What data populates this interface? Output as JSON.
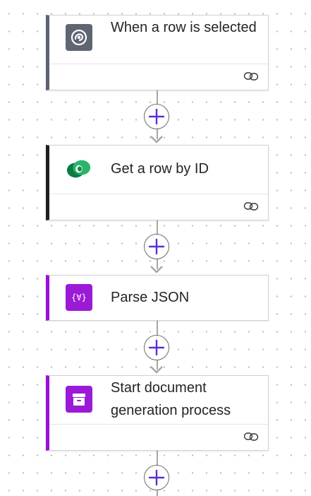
{
  "flow": {
    "steps": [
      {
        "title": "When a row is selected",
        "icon": "dataverse-icon",
        "accent": "#5c6473",
        "icon_bg": "#5f6672",
        "has_link": true
      },
      {
        "title": "Get a row by ID",
        "icon": "dataverse-logo-icon",
        "accent": "#1f1f1f",
        "icon_bg": "#ffffff",
        "has_link": true
      },
      {
        "title": "Parse JSON",
        "icon": "data-operation-icon",
        "accent": "#9b10d9",
        "icon_bg": "#9b1ad6",
        "icon_text": "{∀}",
        "has_link": false
      },
      {
        "title": "Start document generation process",
        "icon": "archive-box-icon",
        "accent": "#9b10d9",
        "icon_bg": "#9b1ad6",
        "has_link": true
      }
    ],
    "add_button_color": "#5b2fd4",
    "connector_color": "#a6a6a6"
  }
}
